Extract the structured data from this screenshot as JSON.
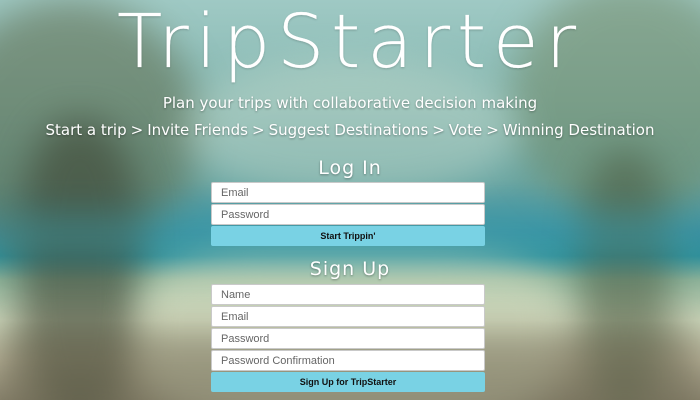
{
  "header": {
    "title": "TripStarter",
    "tagline": "Plan your trips with collaborative decision making",
    "steps": [
      "Start a trip",
      "Invite Friends",
      "Suggest Destinations",
      "Vote",
      "Winning Destination"
    ],
    "step_separator": ">"
  },
  "login": {
    "title": "Log In",
    "email_placeholder": "Email",
    "email_value": "",
    "password_placeholder": "Password",
    "password_value": "",
    "submit_label": "Start Trippin'"
  },
  "signup": {
    "title": "Sign Up",
    "name_placeholder": "Name",
    "name_value": "",
    "email_placeholder": "Email",
    "email_value": "",
    "password_placeholder": "Password",
    "password_value": "",
    "password_confirmation_placeholder": "Password Confirmation",
    "password_confirmation_value": "",
    "submit_label": "Sign Up for TripStarter"
  },
  "colors": {
    "button": "#79d2e4",
    "text": "#ffffff"
  }
}
